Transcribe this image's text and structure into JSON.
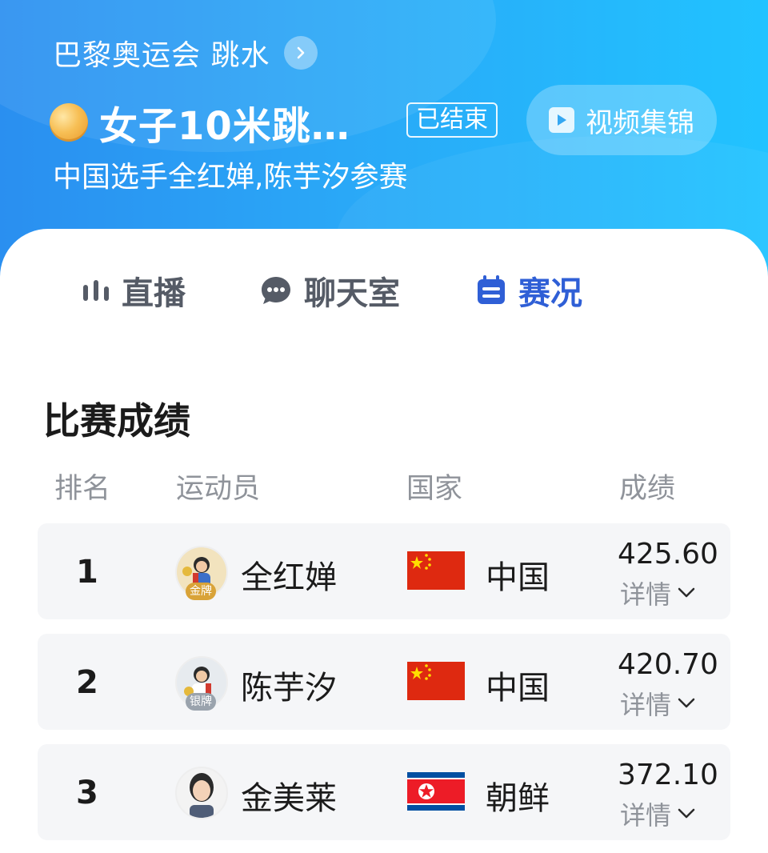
{
  "header": {
    "event": "巴黎奥运会 跳水",
    "title": "女子10米跳…",
    "status": "已结束",
    "video_label": "视频集锦",
    "subtitle": "中国选手全红婵,陈芋汐参赛"
  },
  "tabs": [
    {
      "label": "直播",
      "icon": "live-bars-icon"
    },
    {
      "label": "聊天室",
      "icon": "chat-bubble-icon"
    },
    {
      "label": "赛况",
      "icon": "calendar-icon",
      "active": true
    }
  ],
  "results": {
    "title": "比赛成绩",
    "columns": [
      "排名",
      "运动员",
      "国家",
      "成绩"
    ],
    "rows": [
      {
        "rank": "1",
        "athlete": "全红婵",
        "medal": "金牌",
        "country": "中国",
        "flag": "china-flag",
        "score": "425.60",
        "detail": "详情"
      },
      {
        "rank": "2",
        "athlete": "陈芋汐",
        "medal": "银牌",
        "country": "中国",
        "flag": "china-flag",
        "score": "420.70",
        "detail": "详情"
      },
      {
        "rank": "3",
        "athlete": "金美莱",
        "medal": "",
        "country": "朝鲜",
        "flag": "north-korea-flag",
        "score": "372.10",
        "detail": "详情"
      }
    ]
  },
  "colors": {
    "header_start": "#2a8ff0",
    "header_end": "#21c3ff",
    "active_tab": "#2f5fd6",
    "gold": "#d9a338",
    "silver": "#9aa3ad"
  }
}
